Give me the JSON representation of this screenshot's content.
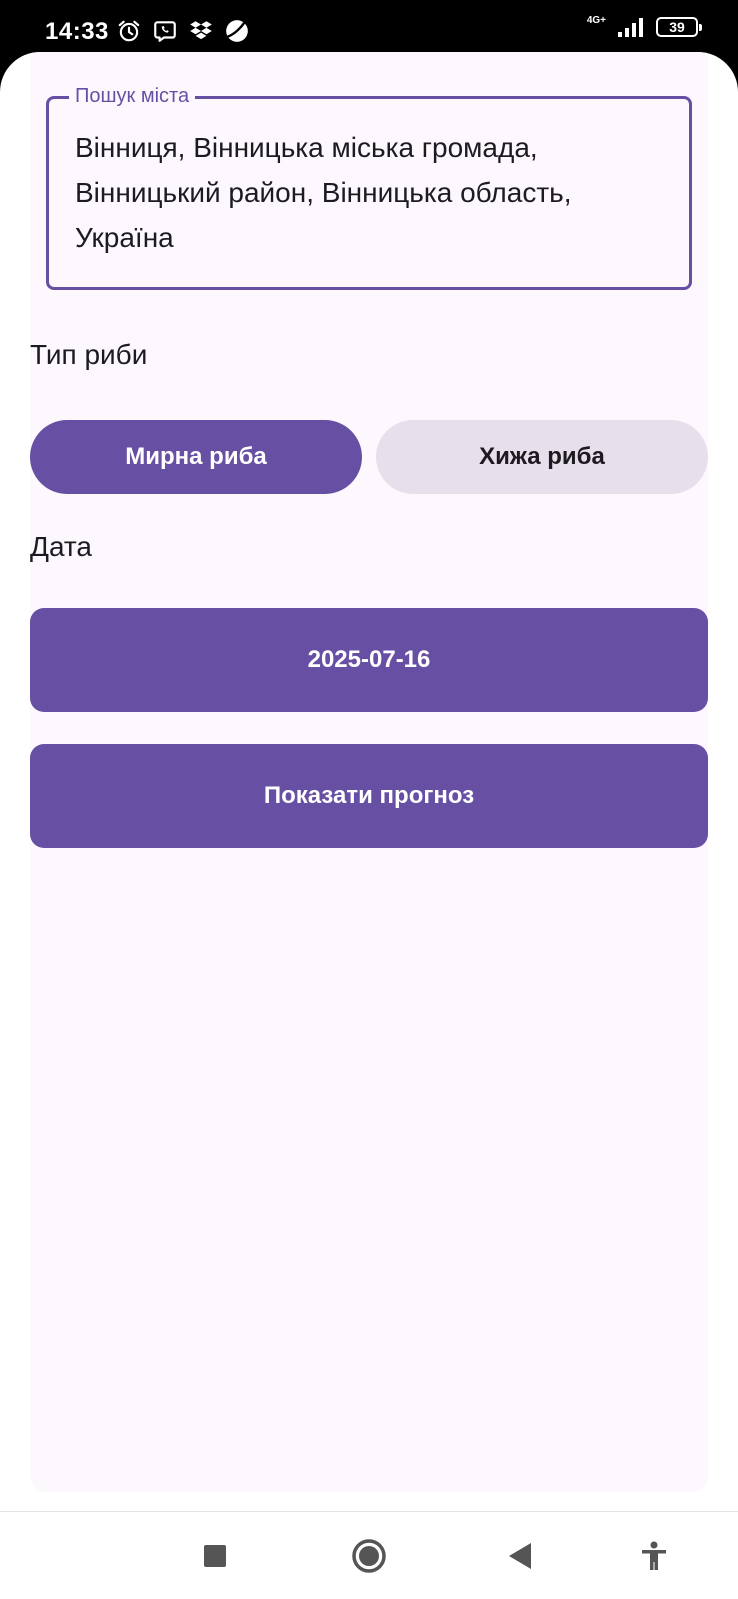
{
  "status_bar": {
    "time": "14:33",
    "network_type": "4G+",
    "battery_level": "39",
    "icons": [
      "alarm-icon",
      "viber-icon",
      "dropbox-icon",
      "app-icon"
    ]
  },
  "search": {
    "label": "Пошук міста",
    "value": "Вінниця, Вінницька міська громада, Вінницький район, Вінницька область, Україна"
  },
  "fish_type": {
    "label": "Тип риби",
    "options": [
      {
        "label": "Мирна риба",
        "selected": true
      },
      {
        "label": "Хижа риба",
        "selected": false
      }
    ]
  },
  "date": {
    "label": "Дата",
    "value": "2025-07-16"
  },
  "forecast_button": {
    "label": "Показати прогноз"
  },
  "colors": {
    "primary": "#6750a4",
    "secondary_container": "#e8dfec",
    "surface": "#fdf8fd",
    "on_surface": "#1d1b20"
  },
  "nav_bar": {
    "buttons": [
      "recents-icon",
      "home-icon",
      "back-icon",
      "accessibility-icon"
    ]
  }
}
